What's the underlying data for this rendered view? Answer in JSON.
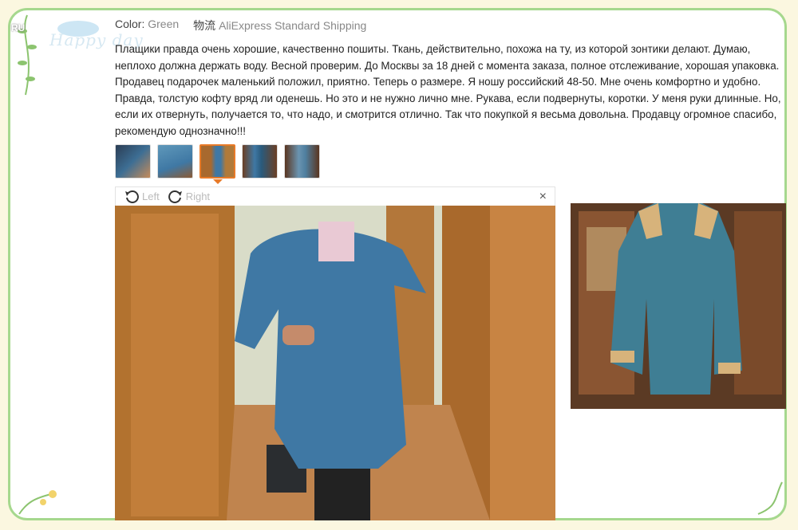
{
  "header": {
    "color_label": "Color:",
    "color_value": "Green",
    "shipping_label": "物流",
    "shipping_value": "AliExpress Standard Shipping",
    "locale": "RU",
    "decor_text": "Happy day"
  },
  "review": {
    "text": "Плащики правда очень хорошие, качественно пошиты. Ткань, действительно, похожа на ту, из которой зонтики делают. Думаю, неплохо должна держать воду. Весной проверим. До Москвы за 18 дней с момента заказа, полное отслеживание, хорошая упаковка. Продавец подарочек маленький положил, приятно. Теперь о размере. Я ношу российский 48-50. Мне очень комфортно и удобно. Правда, толстую кофту вряд ли оденешь. Но это и не нужно лично мне. Рукава, если подвернуты, коротки. У меня руки длинные. Но, если их отвернуть, получается то, что надо, и смотрится отлично. Так что покупкой я весьма довольна. Продавцу огромное спасибо, рекомендую однозначно!!!"
  },
  "thumbnails": [
    {
      "name": "photo-1",
      "active": false
    },
    {
      "name": "photo-2",
      "active": false
    },
    {
      "name": "photo-3",
      "active": true
    },
    {
      "name": "photo-4",
      "active": false
    },
    {
      "name": "photo-5",
      "active": false
    }
  ],
  "viewer": {
    "rotate_left": "Left",
    "rotate_right": "Right",
    "close_glyph": "×"
  },
  "colors": {
    "accent": "#e87a28",
    "frame_border": "#a6d88e",
    "coat_blue": "#3f78a4"
  }
}
